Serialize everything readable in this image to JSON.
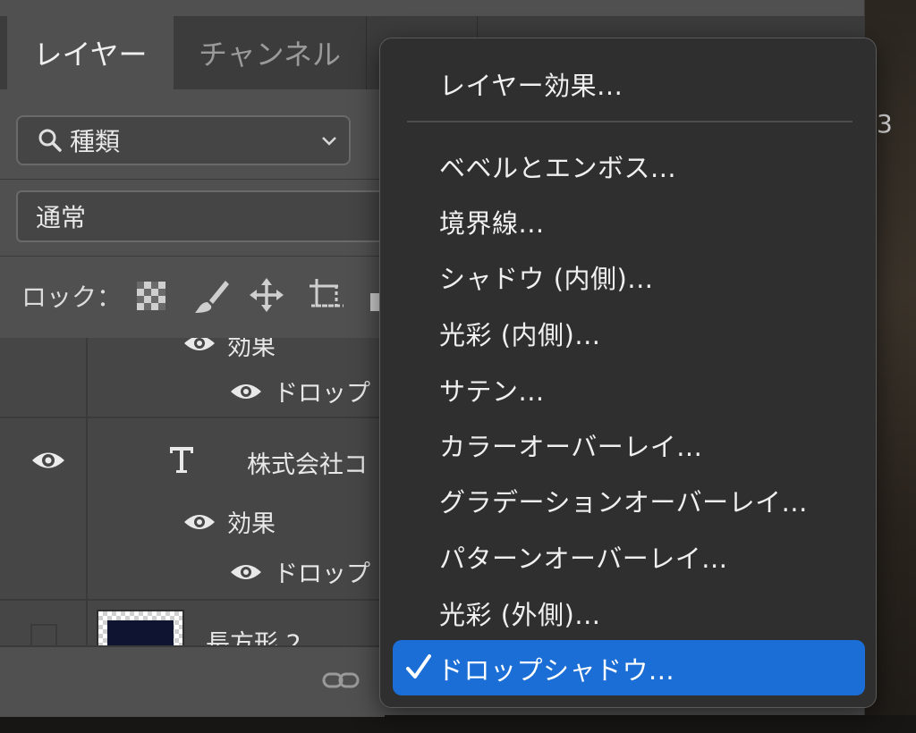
{
  "panel": {
    "tabs": [
      {
        "label": "レイヤー",
        "active": true
      },
      {
        "label": "チャンネル",
        "active": false
      }
    ],
    "filter": {
      "label": "種類"
    },
    "blend_mode": "通常",
    "lock_label": "ロック："
  },
  "layers": {
    "rows": [
      {
        "label": "効果"
      },
      {
        "label": "ドロップ"
      },
      {
        "label": "株式会社コ"
      },
      {
        "label": "効果"
      },
      {
        "label": "ドロップ"
      },
      {
        "label": "長方形 2"
      }
    ]
  },
  "edge_char": "3",
  "menu": {
    "header": "レイヤー効果...",
    "items": [
      "ベベルとエンボス...",
      "境界線...",
      "シャドウ (内側)...",
      "光彩 (内側)...",
      "サテン...",
      "カラーオーバーレイ...",
      "グラデーションオーバーレイ...",
      "パターンオーバーレイ...",
      "光彩 (外側)..."
    ],
    "selected": "ドロップシャドウ..."
  },
  "colors": {
    "accent": "#1b6ed6",
    "menu_bg": "#2f2f2f",
    "panel_bg": "#505050"
  }
}
